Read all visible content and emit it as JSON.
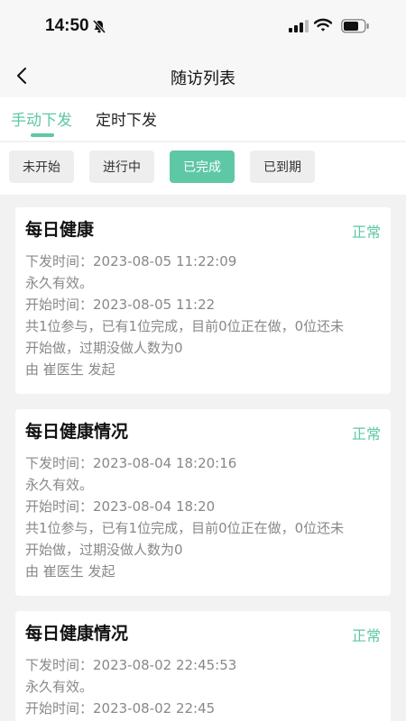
{
  "status_bar": {
    "time": "14:50"
  },
  "nav": {
    "title": "随访列表"
  },
  "tabs": [
    {
      "label": "手动下发",
      "active": true
    },
    {
      "label": "定时下发",
      "active": false
    }
  ],
  "filters": [
    {
      "label": "未开始",
      "active": false
    },
    {
      "label": "进行中",
      "active": false
    },
    {
      "label": "已完成",
      "active": true
    },
    {
      "label": "已到期",
      "active": false
    }
  ],
  "colors": {
    "accent": "#5ec7a6"
  },
  "cards": [
    {
      "title": "每日健康",
      "status": "正常",
      "lines": [
        "下发时间：2023-08-05 11:22:09",
        "永久有效。",
        "开始时间：2023-08-05 11:22",
        "共1位参与，已有1位完成，目前0位正在做，0位还未",
        "开始做，过期没做人数为0",
        "由 崔医生 发起"
      ]
    },
    {
      "title": "每日健康情况",
      "status": "正常",
      "lines": [
        "下发时间：2023-08-04 18:20:16",
        "永久有效。",
        "开始时间：2023-08-04 18:20",
        "共1位参与，已有1位完成，目前0位正在做，0位还未",
        "开始做，过期没做人数为0",
        "由 崔医生 发起"
      ]
    },
    {
      "title": "每日健康情况",
      "status": "正常",
      "lines": [
        "下发时间：2023-08-02 22:45:53",
        "永久有效。",
        "开始时间：2023-08-02 22:45"
      ]
    }
  ]
}
